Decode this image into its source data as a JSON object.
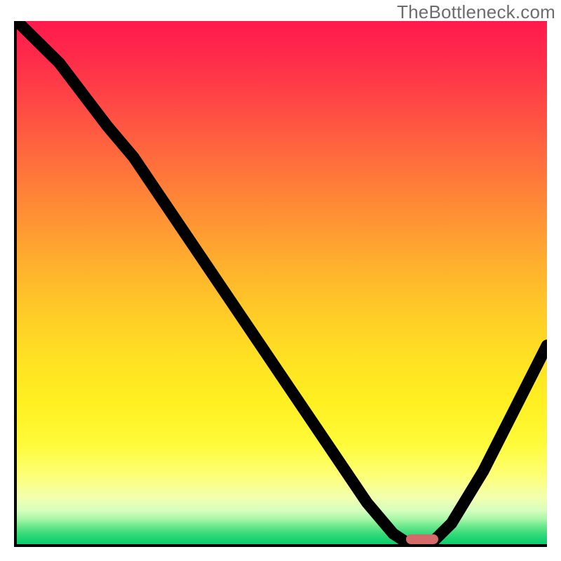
{
  "watermark": "TheBottleneck.com",
  "chart_data": {
    "type": "line",
    "title": "",
    "xlabel": "",
    "ylabel": "",
    "xlim": [
      0,
      100
    ],
    "ylim": [
      0,
      100
    ],
    "grid": false,
    "legend": false,
    "background": "red-to-green vertical gradient (red top, green bottom)",
    "series": [
      {
        "name": "bottleneck-curve",
        "x": [
          0,
          8,
          17,
          22,
          30,
          40,
          50,
          58,
          66,
          71,
          74,
          78,
          82,
          88,
          94,
          100
        ],
        "y": [
          100,
          92,
          80,
          74,
          62,
          47,
          32,
          20,
          8,
          2,
          0,
          0,
          4,
          14,
          26,
          38
        ]
      }
    ],
    "marker": {
      "x": 76,
      "y": 1.5,
      "shape": "pill",
      "color": "#d46a6a"
    },
    "gradient_stops": [
      {
        "pct": 0,
        "color": "#ff1a4d"
      },
      {
        "pct": 36,
        "color": "#ff8d35"
      },
      {
        "pct": 73,
        "color": "#fff021"
      },
      {
        "pct": 95,
        "color": "#6ee98d"
      },
      {
        "pct": 100,
        "color": "#0ecd6c"
      }
    ]
  }
}
